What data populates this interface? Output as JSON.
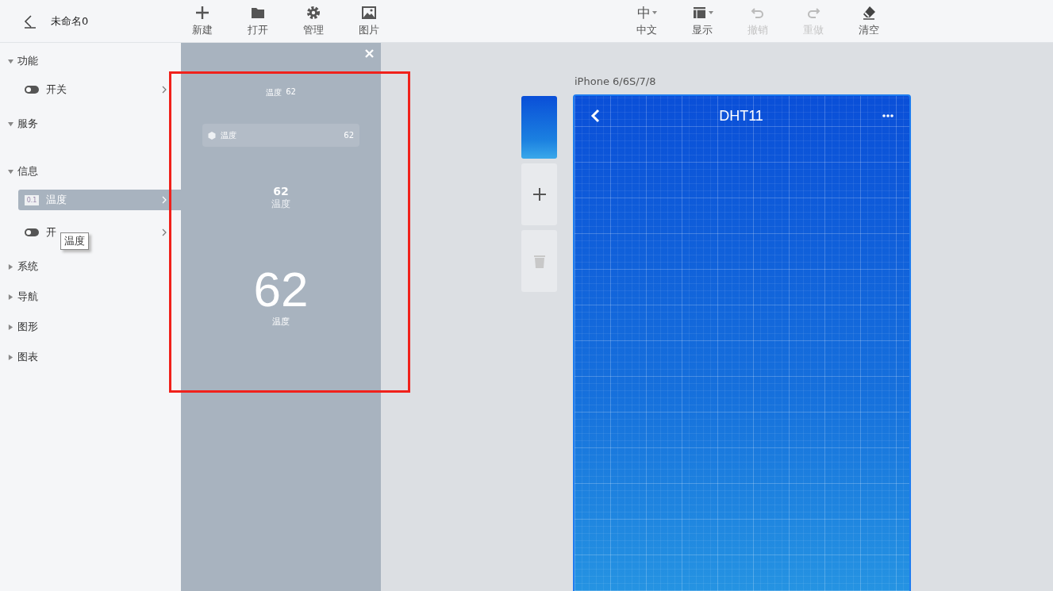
{
  "header": {
    "title": "未命名0"
  },
  "toolbar_left": [
    {
      "label": "新建",
      "disabled": false,
      "dropdown": false
    },
    {
      "label": "打开",
      "disabled": false,
      "dropdown": false
    },
    {
      "label": "管理",
      "disabled": false,
      "dropdown": false
    },
    {
      "label": "图片",
      "disabled": false,
      "dropdown": false
    }
  ],
  "toolbar_right": [
    {
      "label": "中文",
      "glyph": "中",
      "disabled": false,
      "dropdown": true
    },
    {
      "label": "显示",
      "disabled": false,
      "dropdown": true
    },
    {
      "label": "撤销",
      "disabled": true,
      "dropdown": false
    },
    {
      "label": "重做",
      "disabled": true,
      "dropdown": false
    },
    {
      "label": "清空",
      "disabled": false,
      "dropdown": false
    }
  ],
  "sidebar": {
    "groups": [
      {
        "label": "功能",
        "expanded": true,
        "children": [
          {
            "label": "开关",
            "kind": "switch",
            "selected": false
          }
        ]
      },
      {
        "label": "服务",
        "expanded": true
      },
      {
        "label": "信息",
        "expanded": true,
        "children": [
          {
            "label": "温度",
            "kind": "value",
            "badge": "0.1",
            "selected": true
          },
          {
            "label": "开",
            "kind": "switch",
            "selected": false,
            "tooltip": "温度"
          }
        ]
      },
      {
        "label": "系统",
        "expanded": false
      },
      {
        "label": "导航",
        "expanded": false
      },
      {
        "label": "图形",
        "expanded": false
      },
      {
        "label": "图表",
        "expanded": false
      }
    ]
  },
  "preview": {
    "widgets": [
      {
        "kind": "inline",
        "label": "温度",
        "value": "62"
      },
      {
        "kind": "row",
        "label": "温度",
        "value": "62"
      },
      {
        "kind": "small",
        "label": "温度",
        "value": "62"
      },
      {
        "kind": "large",
        "label": "温度",
        "value": "62"
      }
    ]
  },
  "device": {
    "name": "iPhone 6/6S/7/8",
    "title": "DHT11"
  }
}
